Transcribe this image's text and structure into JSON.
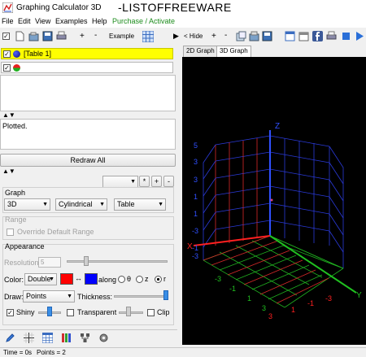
{
  "window": {
    "title": "Graphing Calculator 3D",
    "brand": "-LISTOFFREEWARE"
  },
  "menu": [
    {
      "label": "File"
    },
    {
      "label": "Edit"
    },
    {
      "label": "View"
    },
    {
      "label": "Examples"
    },
    {
      "label": "Help"
    },
    {
      "label": "Purchase / Activate"
    }
  ],
  "toolbar": {
    "example_label": "Example",
    "plus": "+",
    "minus": "-"
  },
  "right_toolbar": {
    "hide_label": "< Hide",
    "plus": "+",
    "minus": "-"
  },
  "equations": [
    {
      "text": "[Table 1]",
      "checked": true,
      "color": "#1a237e"
    },
    {
      "text": "",
      "checked": true,
      "color": "#d81b1b"
    }
  ],
  "status_message": "Plotted.",
  "redraw_label": "Redraw All",
  "graph": {
    "section_label": "Graph",
    "dimension": "3D",
    "coordinate_system": "Cylindrical",
    "type": "Table"
  },
  "range": {
    "section_label": "Range",
    "override_label": "Override Default Range"
  },
  "appearance": {
    "section_label": "Appearance",
    "resolution_label": "Resolution:",
    "resolution_value": "5",
    "color_label": "Color:",
    "color_mode": "Double",
    "color_a": "#ff0000",
    "color_b": "#0000ff",
    "along_label": "along",
    "along_options": [
      "θ",
      "z",
      "r"
    ],
    "along_selected": "r",
    "draw_label": "Draw:",
    "draw_mode": "Points",
    "thickness_label": "Thickness:",
    "shiny_label": "Shiny",
    "transparent_label": "Transparent",
    "clip_label": "Clip"
  },
  "tabs": [
    {
      "label": "2D Graph"
    },
    {
      "label": "3D Graph",
      "active": true
    }
  ],
  "status_bar": {
    "time": "Time = 0s",
    "points": "Points = 2"
  },
  "axes": {
    "x_label": "X",
    "y_label": "Y",
    "z_label": "Z",
    "z_ticks": [
      "5",
      "3",
      "1",
      "-1",
      "-3"
    ],
    "x_ticks": [
      "3",
      "1",
      "-1",
      "-3"
    ],
    "y_ticks": [
      "-3",
      "-1",
      "1",
      "3"
    ],
    "x_color": "#ff2020",
    "y_color": "#20c020",
    "z_color": "#3050ff"
  }
}
